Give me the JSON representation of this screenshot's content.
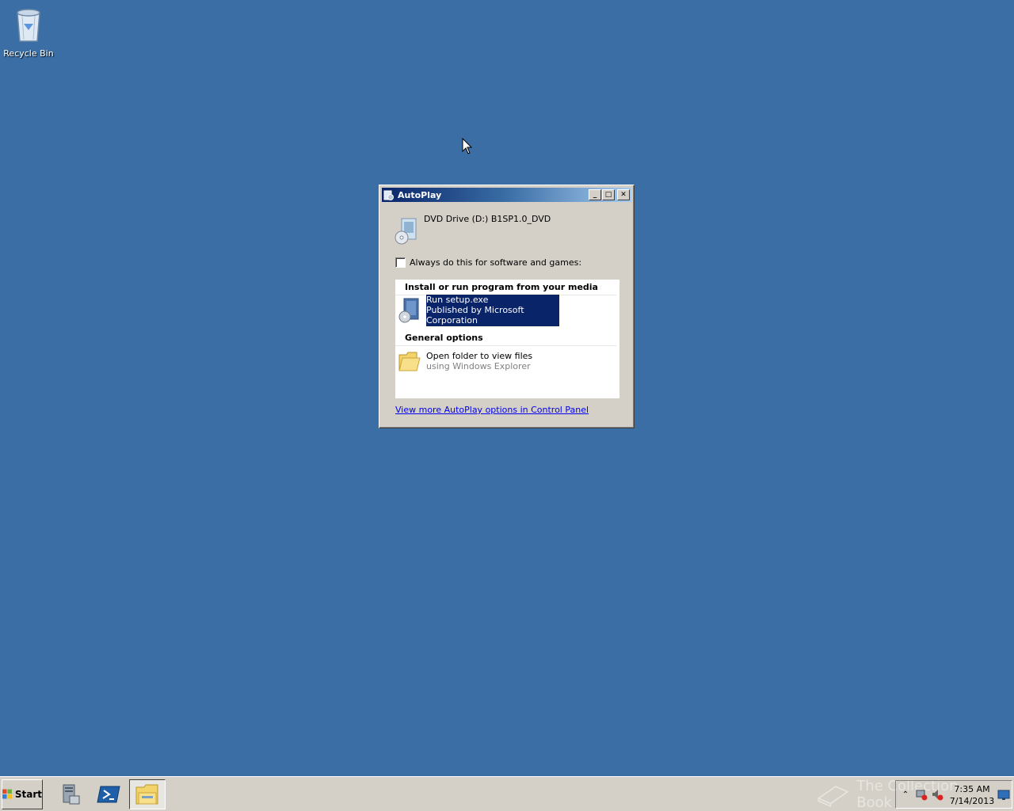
{
  "desktop": {
    "icons": [
      {
        "label": "Recycle Bin",
        "icon": "recycle-bin-icon"
      }
    ]
  },
  "autoplay": {
    "title": "AutoPlay",
    "drive_label": "DVD Drive (D:) B1SP1.0_DVD",
    "always_checkbox_label": "Always do this for software and games:",
    "always_checked": false,
    "sections": [
      {
        "heading": "Install or run program from your media",
        "options": [
          {
            "title": "Run setup.exe",
            "subtitle": "Published by Microsoft Corporation",
            "selected": true,
            "icon": "setup-icon"
          }
        ]
      },
      {
        "heading": "General options",
        "options": [
          {
            "title": "Open folder to view files",
            "subtitle": "using Windows Explorer",
            "selected": false,
            "icon": "folder-icon"
          }
        ]
      }
    ],
    "control_panel_link": "View more AutoPlay options in Control Panel"
  },
  "taskbar": {
    "start_label": "Start",
    "apps": [
      {
        "name": "server-manager",
        "icon": "server-manager-icon"
      },
      {
        "name": "powershell",
        "icon": "powershell-icon"
      },
      {
        "name": "windows-explorer",
        "icon": "explorer-folder-icon",
        "active": true
      }
    ],
    "watermark": "The Collection Book",
    "clock": {
      "time": "7:35 AM",
      "date": "7/14/2013"
    }
  },
  "colors": {
    "desktop": "#3a6ea5",
    "titlebar_start": "#0a246a",
    "titlebar_end": "#a6caf0",
    "selection": "#0a246a",
    "link": "#0000ee",
    "chrome": "#d4d0c8"
  }
}
